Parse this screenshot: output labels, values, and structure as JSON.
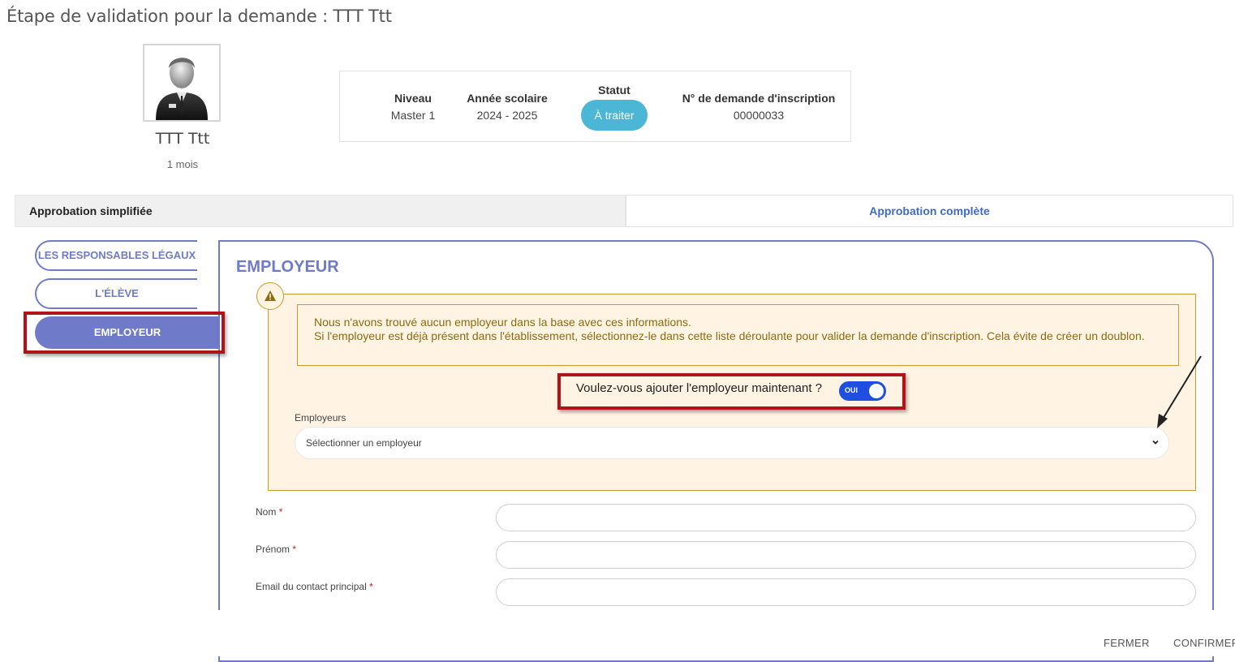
{
  "page": {
    "title": "Étape de validation pour la demande : TTT Ttt"
  },
  "student": {
    "name": "TTT Ttt",
    "age": "1 mois"
  },
  "info_card": {
    "level_label": "Niveau",
    "level_value": "Master 1",
    "year_label": "Année scolaire",
    "year_value": "2024 - 2025",
    "status_label": "Statut",
    "status_value": "À traiter",
    "request_label": "N° de demande d'inscription",
    "request_value": "00000033"
  },
  "tabs": {
    "simplified": "Approbation simplifiée",
    "complete": "Approbation complète"
  },
  "sidebar": {
    "items": [
      {
        "label": "LES RESPONSABLES LÉGAUX"
      },
      {
        "label": "L'ÉLÈVE"
      },
      {
        "label": "EMPLOYEUR"
      }
    ]
  },
  "section": {
    "title": "EMPLOYEUR",
    "alert_line1": "Nous n'avons trouvé aucun employeur dans la base avec ces informations.",
    "alert_line2": "Si l'employeur est déjà présent dans l'établissement, sélectionnez-le dans cette liste déroulante pour valider la demande d'inscription. Cela évite de créer un doublon.",
    "question": "Voulez-vous ajouter l'employeur maintenant ?",
    "toggle_label": "OUI",
    "employers_label": "Employeurs",
    "employers_placeholder": "Sélectionner un employeur"
  },
  "fields": [
    {
      "label": "Nom",
      "required": "*"
    },
    {
      "label": "Prénom",
      "required": "*"
    },
    {
      "label": "Email du contact principal",
      "required": "*"
    }
  ],
  "footer": {
    "close": "FERMER",
    "confirm": "CONFIRMER"
  },
  "colors": {
    "accent": "#6f7bc8",
    "status": "#4bb6d6",
    "toggle": "#1f4fe0",
    "alert_bg": "#fff4e3",
    "alert_border": "#c99b2a",
    "highlight": "#b01419"
  }
}
